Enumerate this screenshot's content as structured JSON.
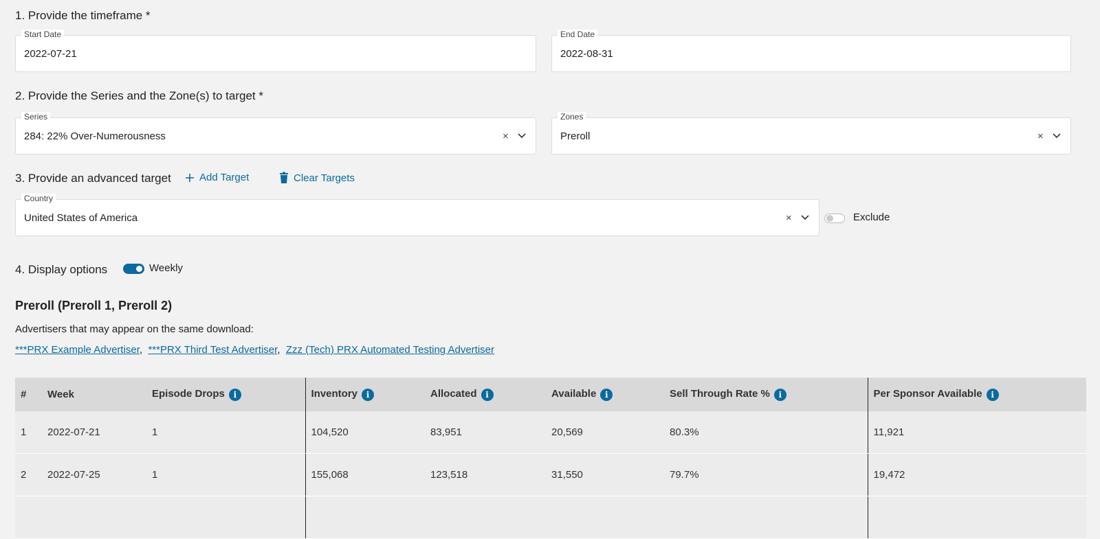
{
  "sections": {
    "timeframe": "1. Provide the timeframe *",
    "series_zones": "2. Provide the Series and the Zone(s) to target *",
    "advanced": "3. Provide an advanced target",
    "display": "4. Display options"
  },
  "timeframe": {
    "start_label": "Start Date",
    "start_value": "2022-07-21",
    "end_label": "End Date",
    "end_value": "2022-08-31"
  },
  "series": {
    "label": "Series",
    "value": "284: 22% Over-Numerousness"
  },
  "zones": {
    "label": "Zones",
    "value": "Preroll"
  },
  "advanced": {
    "add_target": "Add Target",
    "clear_targets": "Clear Targets",
    "country_label": "Country",
    "country_value": "United States of America",
    "exclude_label": "Exclude",
    "exclude_on": false
  },
  "display": {
    "weekly_label": "Weekly",
    "weekly_on": true
  },
  "results": {
    "heading": "Preroll (Preroll 1, Preroll 2)",
    "advertisers_intro": "Advertisers that may appear on the same download:",
    "advertisers": [
      "***PRX Example Advertiser",
      "***PRX Third Test Advertiser",
      "Zzz (Tech) PRX Automated Testing Advertiser"
    ],
    "sep": ","
  },
  "table": {
    "headers": {
      "num": "#",
      "week": "Week",
      "drops": "Episode Drops",
      "inventory": "Inventory",
      "allocated": "Allocated",
      "available": "Available",
      "str": "Sell Through Rate %",
      "psa": "Per Sponsor Available"
    },
    "rows": [
      {
        "num": "1",
        "week": "2022-07-21",
        "drops": "1",
        "inventory": "104,520",
        "allocated": "83,951",
        "available": "20,569",
        "str": "80.3%",
        "psa": "11,921"
      },
      {
        "num": "2",
        "week": "2022-07-25",
        "drops": "1",
        "inventory": "155,068",
        "allocated": "123,518",
        "available": "31,550",
        "str": "79.7%",
        "psa": "19,472"
      }
    ]
  },
  "colors": {
    "accent": "#0b6a9e",
    "header_bg": "#d9d9d9",
    "row_bg": "#ececec"
  }
}
